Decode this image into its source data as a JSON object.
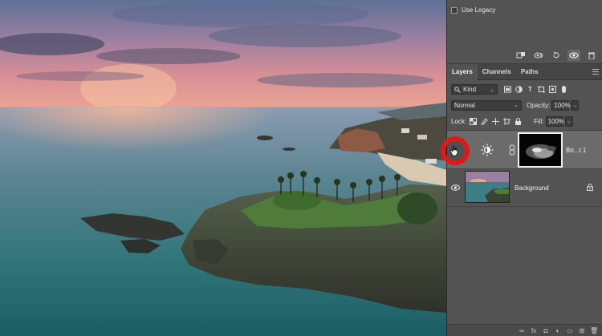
{
  "properties": {
    "use_legacy_label": "Use Legacy",
    "buttons": [
      "clip-to-layer-icon",
      "view-previous-icon",
      "reset-icon",
      "visibility-icon",
      "trash-icon"
    ]
  },
  "tabs": [
    {
      "label": "Layers",
      "active": true
    },
    {
      "label": "Channels",
      "active": false
    },
    {
      "label": "Paths",
      "active": false
    }
  ],
  "filter": {
    "kind_label": "Kind",
    "icons": [
      "pixel-filter-icon",
      "adjustment-filter-icon",
      "type-filter-icon",
      "shape-filter-icon",
      "smart-object-filter-icon",
      "filter-toggle-icon"
    ]
  },
  "blend": {
    "mode": "Normal",
    "opacity_label": "Opacity:",
    "opacity_value": "100%"
  },
  "lock": {
    "label": "Lock:",
    "icons": [
      "lock-transparent-icon",
      "lock-image-icon",
      "lock-position-icon",
      "lock-artboard-icon",
      "lock-all-icon"
    ],
    "fill_label": "Fill:",
    "fill_value": "100%"
  },
  "layers": [
    {
      "name": "Bri...t 1",
      "type": "adjustment",
      "selected": true,
      "adjustment_icon": "brightness-contrast-icon",
      "visibility": "hidden"
    },
    {
      "name": "Background",
      "type": "image",
      "selected": false,
      "locked": true,
      "visibility": "visible"
    }
  ],
  "footer_icons": [
    "link-layers-icon",
    "fx-icon",
    "add-mask-icon",
    "new-adjustment-icon",
    "new-group-icon",
    "new-layer-icon",
    "delete-layer-icon"
  ],
  "footer_glyphs": [
    "∞",
    "fx",
    "◘",
    "◐",
    "▭",
    "⊞",
    "🗑"
  ],
  "colors": {
    "panel": "#535353",
    "selected_row": "#6b6b6b",
    "highlight_ring": "#e01818"
  }
}
